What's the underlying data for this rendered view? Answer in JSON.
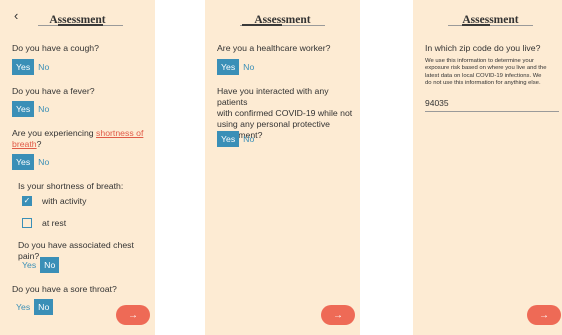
{
  "screen1": {
    "title": "Assessment",
    "back_icon": "chevron-left-icon",
    "q_cough": "Do you have a cough?",
    "q_fever": "Do you have a fever?",
    "q_breath_prefix": "Are you experiencing ",
    "q_breath_link_1": "shortness of",
    "q_breath_link_2": "breath",
    "q_breath_suffix": "?",
    "q_breath_type": "Is your shortness of breath:",
    "opt_activity": "with activity",
    "opt_rest": "at rest",
    "q_chest": "Do you have associated chest pain?",
    "q_throat": "Do you have a sore throat?",
    "yes": "Yes",
    "no": "No"
  },
  "screen2": {
    "title": "Assessment",
    "q_worker": "Are you a healthcare worker?",
    "q_contact_1": "Have you interacted with any patients",
    "q_contact_2": "with confirmed COVID-19 while not",
    "q_contact_3": "using any personal protective",
    "q_contact_4": "equipment?",
    "yes": "Yes",
    "no": "No"
  },
  "screen3": {
    "title": "Assessment",
    "q_zip": "In which zip code do you live?",
    "note_1": "We use this information to determine your",
    "note_2": "exposure risk based on where you live and the",
    "note_3": "latest data on local COVID-19 infections. We",
    "note_4": "do not use this information for anything else.",
    "zip_value": "94035"
  },
  "next_icon": "arrow-right-icon",
  "next_glyph": "→",
  "back_glyph": "‹",
  "check_glyph": "✓",
  "colors": {
    "accent": "#3a8fb7",
    "button": "#ee6a56",
    "background": "#fdebd3"
  }
}
